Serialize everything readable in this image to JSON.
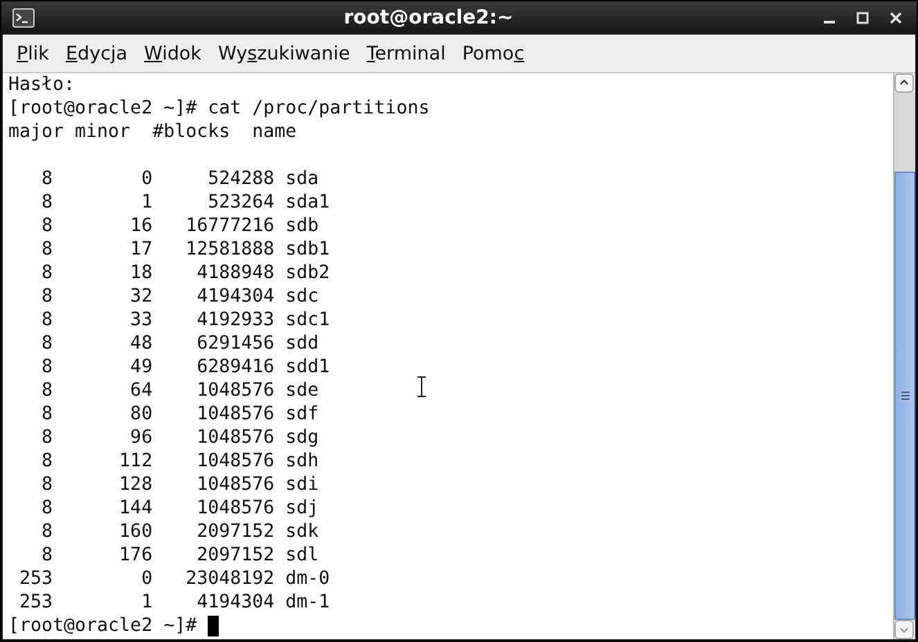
{
  "window": {
    "title": "root@oracle2:~"
  },
  "menu": [
    {
      "key": "P",
      "after": "lik"
    },
    {
      "key": "E",
      "after": "dycja"
    },
    {
      "key": "W",
      "after": "idok"
    },
    {
      "before": "Wy",
      "key": "s",
      "after": "zukiwanie"
    },
    {
      "key": "T",
      "after": "erminal"
    },
    {
      "before": "Pomo",
      "key": "c"
    }
  ],
  "terminal": {
    "lines": [
      {
        "kind": "text",
        "text": "Hasło:"
      },
      {
        "kind": "text",
        "text": "[root@oracle2 ~]# cat /proc/partitions"
      },
      {
        "kind": "text",
        "text": "major minor  #blocks  name"
      },
      {
        "kind": "blank"
      },
      {
        "kind": "text",
        "text": "   8        0     524288 sda"
      },
      {
        "kind": "text",
        "text": "   8        1     523264 sda1"
      },
      {
        "kind": "text",
        "text": "   8       16   16777216 sdb"
      },
      {
        "kind": "text",
        "text": "   8       17   12581888 sdb1"
      },
      {
        "kind": "text",
        "text": "   8       18    4188948 sdb2"
      },
      {
        "kind": "text",
        "text": "   8       32    4194304 sdc"
      },
      {
        "kind": "text",
        "text": "   8       33    4192933 sdc1"
      },
      {
        "kind": "text",
        "text": "   8       48    6291456 sdd"
      },
      {
        "kind": "text",
        "text": "   8       49    6289416 sdd1"
      },
      {
        "kind": "text",
        "text": "   8       64    1048576 sde"
      },
      {
        "kind": "text",
        "text": "   8       80    1048576 sdf"
      },
      {
        "kind": "text",
        "text": "   8       96    1048576 sdg"
      },
      {
        "kind": "text",
        "text": "   8      112    1048576 sdh"
      },
      {
        "kind": "text",
        "text": "   8      128    1048576 sdi"
      },
      {
        "kind": "text",
        "text": "   8      144    1048576 sdj"
      },
      {
        "kind": "text",
        "text": "   8      160    2097152 sdk"
      },
      {
        "kind": "text",
        "text": "   8      176    2097152 sdl"
      },
      {
        "kind": "text",
        "text": " 253        0   23048192 dm-0"
      },
      {
        "kind": "text",
        "text": " 253        1    4194304 dm-1"
      },
      {
        "kind": "prompt",
        "text": "[root@oracle2 ~]# "
      }
    ]
  }
}
